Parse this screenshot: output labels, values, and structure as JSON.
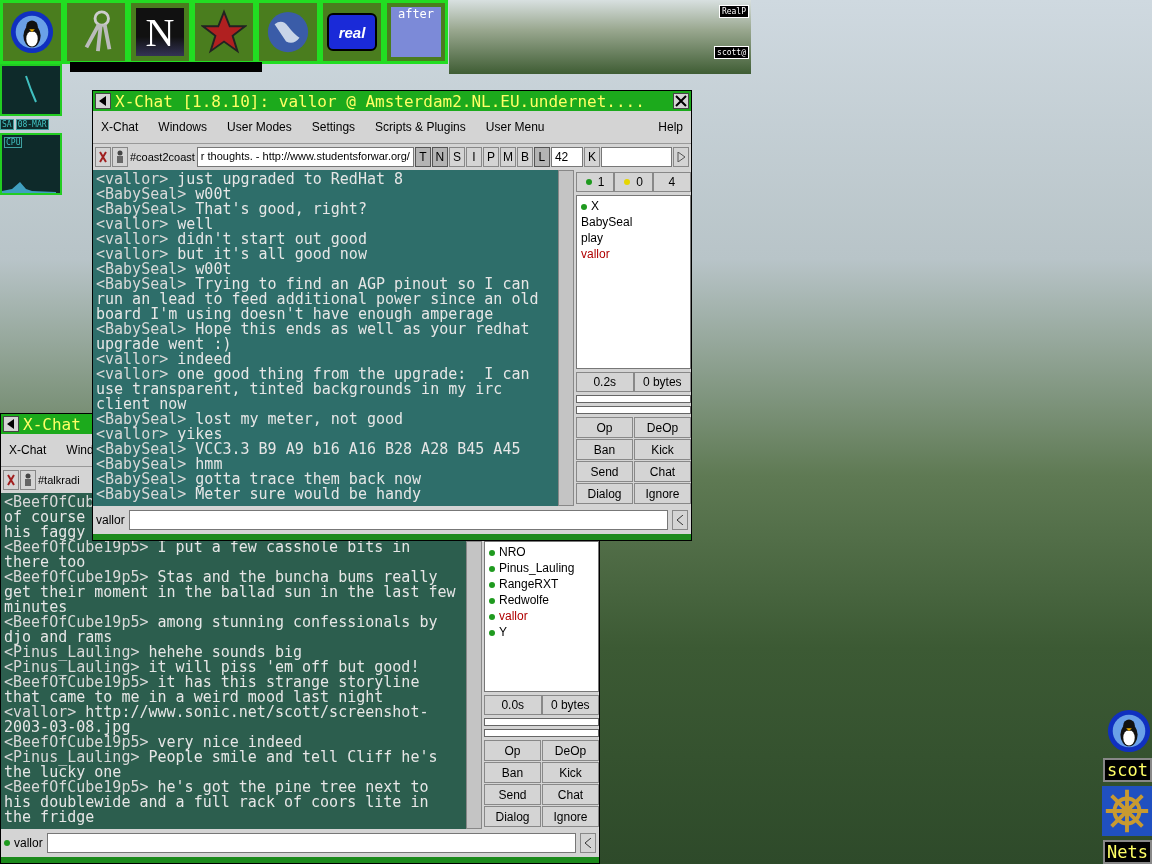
{
  "dock": {
    "launchers": [
      {
        "kind": "penguin"
      },
      {
        "kind": "keys"
      },
      {
        "kind": "letter",
        "label": "N"
      },
      {
        "kind": "star"
      },
      {
        "kind": "globe"
      },
      {
        "kind": "badge",
        "label": "real"
      },
      {
        "kind": "cube",
        "label": "after"
      }
    ]
  },
  "pager": {
    "labels": [
      "RealP",
      "scott@"
    ]
  },
  "clock": {
    "day": "SA",
    "date": "08-MAR"
  },
  "cpu": {
    "label": "CPU"
  },
  "front_window": {
    "title": "X-Chat [1.8.10]: vallor @ Amsterdam2.NL.EU.undernet....",
    "menu": [
      {
        "label": "X-Chat",
        "right": false
      },
      {
        "label": "Windows",
        "right": false
      },
      {
        "label": "User Modes",
        "right": false
      },
      {
        "label": "Settings",
        "right": false
      },
      {
        "label": "Scripts & Plugins",
        "right": false
      },
      {
        "label": "User Menu",
        "right": false
      },
      {
        "label": "Help",
        "right": true
      }
    ],
    "channel": "#coast2coast",
    "topic": "r thoughts. - http://www.studentsforwar.org/",
    "modes": [
      {
        "label": "T",
        "on": true
      },
      {
        "label": "N",
        "on": true
      },
      {
        "label": "S",
        "on": false
      },
      {
        "label": "I",
        "on": false
      },
      {
        "label": "P",
        "on": false
      },
      {
        "label": "M",
        "on": false
      },
      {
        "label": "B",
        "on": false
      },
      {
        "label": "L",
        "on": true
      }
    ],
    "limit": "42",
    "key_button": "K",
    "lines": [
      {
        "nick": "<vallor>",
        "text": "just upgraded to RedHat 8"
      },
      {
        "nick": "<BabySeal>",
        "text": "w00t"
      },
      {
        "nick": "<BabySeal>",
        "text": "That's good, right?"
      },
      {
        "nick": "<vallor>",
        "text": "well"
      },
      {
        "nick": "<vallor>",
        "text": "didn't start out good"
      },
      {
        "nick": "<vallor>",
        "text": "but it's all good now"
      },
      {
        "nick": "<BabySeal>",
        "text": "w00t"
      },
      {
        "nick": "<BabySeal>",
        "text": "Trying to find an AGP pinout so I can run an lead to feed additional power since an old board I'm using doesn't have enough amperage"
      },
      {
        "nick": "<BabySeal>",
        "text": "Hope this ends as well as your redhat upgrade went :)"
      },
      {
        "nick": "<vallor>",
        "text": "indeed"
      },
      {
        "nick": "<vallor>",
        "text": "one good thing from the upgrade:  I can use transparent, tinted backgrounds in my irc client now"
      },
      {
        "nick": "<BabySeal>",
        "text": "lost my meter, not good"
      },
      {
        "nick": "<vallor>",
        "text": "yikes"
      },
      {
        "nick": "<BabySeal>",
        "text": "VCC3.3 B9 A9 b16 A16 B28 A28 B45 A45"
      },
      {
        "nick": "<BabySeal>",
        "text": "hmm"
      },
      {
        "nick": "<BabySeal>",
        "text": "gotta trace them back now"
      },
      {
        "nick": "<BabySeal>",
        "text": "Meter sure would be handy"
      }
    ],
    "counts": [
      {
        "label": "1",
        "color": "#1f9a1f"
      },
      {
        "label": "0",
        "color": "#e6d600"
      },
      {
        "label": "4"
      }
    ],
    "users": [
      {
        "name": "X",
        "op": true
      },
      {
        "name": "BabySeal",
        "op": false
      },
      {
        "name": "play",
        "op": false
      },
      {
        "name": "vallor",
        "op": false,
        "color": "#b00000"
      }
    ],
    "lag": "0.2s",
    "throughput": "0 bytes",
    "buttons": [
      "Op",
      "DeOp",
      "Ban",
      "Kick",
      "Send",
      "Chat",
      "Dialog",
      "Ignore"
    ],
    "nick": "vallor"
  },
  "back_window": {
    "title": "X-Chat",
    "menu": [
      {
        "label": "X-Chat",
        "right": false
      },
      {
        "label": "Wind",
        "right": false
      }
    ],
    "channel": "#talkradi",
    "lines": [
      {
        "nick": "<BeefOfCub"
      },
      {
        "text": "of course"
      },
      {
        "text": "his faggy"
      },
      {
        "nick": "<BeefOfCube19p5>",
        "text": "I put a few casshole bits in there too"
      },
      {
        "nick": "<BeefOfCube19p5>",
        "text": "Stas and the buncha bums really get their moment in the ballad sun in the last few minutes"
      },
      {
        "nick": "<BeefOfCube19p5>",
        "text": "among stunning confessionals by djo and rams"
      },
      {
        "nick": "<Pinus_Lauling>",
        "text": "hehehe sounds big"
      },
      {
        "nick": "<Pinus_Lauling>",
        "text": "it will piss 'em off but good!"
      },
      {
        "nick": "<BeefOfCube19p5>",
        "text": "it has this strange storyline that came to me in a weird mood last night"
      },
      {
        "nick": "<vallor>",
        "text": "http://www.sonic.net/scott/screenshot-2003-03-08.jpg"
      },
      {
        "nick": "<BeefOfCube19p5>",
        "text": "very nice indeed"
      },
      {
        "nick": "<Pinus_Lauling>",
        "text": "People smile and tell Cliff he's the lucky one"
      },
      {
        "nick": "<BeefOfCube19p5>",
        "text": "he's got the pine tree next to his doublewide and a full rack of coors lite in the fridge"
      }
    ],
    "users": [
      {
        "name": "NRO",
        "op": true
      },
      {
        "name": "Pinus_Lauling",
        "op": true
      },
      {
        "name": "RangeRXT",
        "op": true
      },
      {
        "name": "Redwolfe",
        "op": true
      },
      {
        "name": "vallor",
        "op": true,
        "color": "#b00000"
      },
      {
        "name": "Y",
        "op": true
      }
    ],
    "lag": "0.0s",
    "throughput": "0 bytes",
    "buttons": [
      "Op",
      "DeOp",
      "Ban",
      "Kick",
      "Send",
      "Chat",
      "Dialog",
      "Ignore"
    ],
    "nick": "vallor",
    "online": true
  },
  "tray": {
    "items": [
      {
        "kind": "penguin"
      },
      {
        "kind": "label",
        "label": "scot"
      },
      {
        "kind": "wheel"
      },
      {
        "kind": "label",
        "label": "Nets"
      }
    ]
  }
}
